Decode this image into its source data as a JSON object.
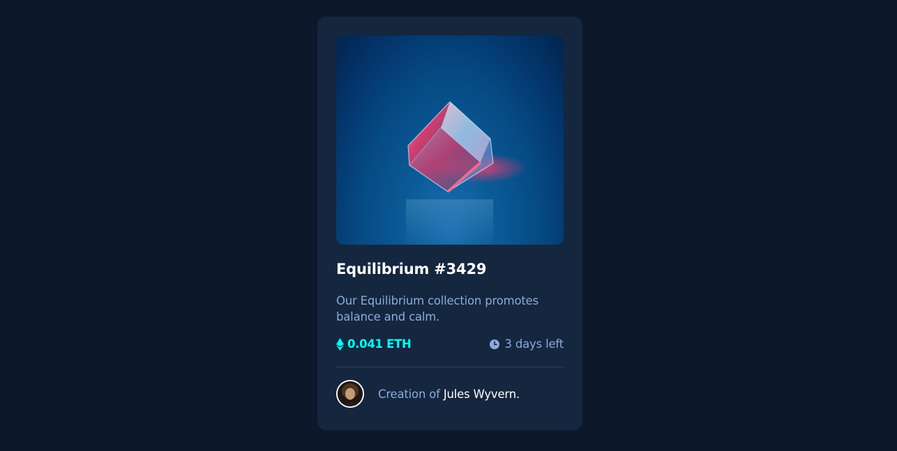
{
  "card": {
    "title": "Equilibrium #3429",
    "description": "Our Equilibrium collection promotes balance and calm.",
    "price": "0.041 ETH",
    "time_left": "3 days left",
    "creator_prefix": "Creation of ",
    "creator_name": "Jules Wyvern."
  },
  "icons": {
    "price": "ethereum-icon",
    "time": "clock-icon"
  },
  "colors": {
    "page_bg": "#0d192b",
    "card_bg": "#15263f",
    "accent_cyan": "#00fff8",
    "soft_blue": "#8bacd9",
    "white": "#ffffff"
  }
}
